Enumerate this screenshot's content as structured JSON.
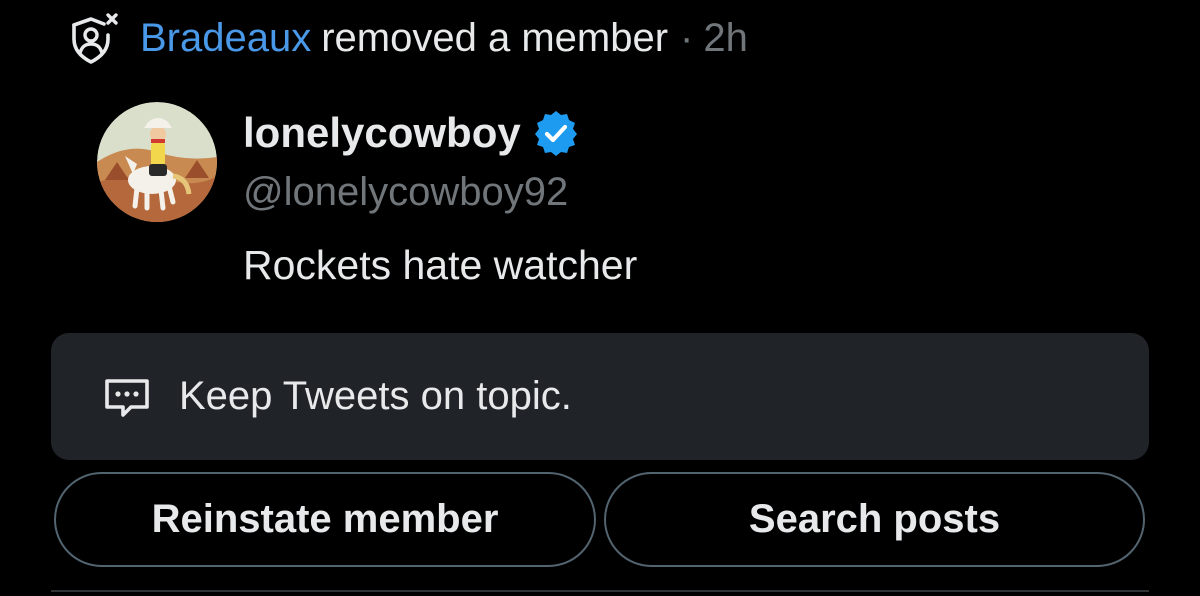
{
  "activity": {
    "icon": "shield-remove-member-icon",
    "actor": "Bradeaux",
    "action": "removed a member",
    "separator": "·",
    "time": "2h"
  },
  "member": {
    "avatar_icon": "cowboy-avatar",
    "display_name": "lonelycowboy",
    "verified_icon": "verified-badge-icon",
    "handle": "@lonelycowboy92",
    "bio": "Rockets hate watcher"
  },
  "reason": {
    "icon": "message-dots-icon",
    "text": "Keep Tweets on topic."
  },
  "buttons": {
    "reinstate_label": "Reinstate member",
    "search_label": "Search posts"
  },
  "colors": {
    "background": "#000000",
    "accent_link": "#4a99e9",
    "secondary_text": "#71767b",
    "verified": "#1d9bf0",
    "reason_box": "#202327",
    "button_border": "#536471"
  }
}
